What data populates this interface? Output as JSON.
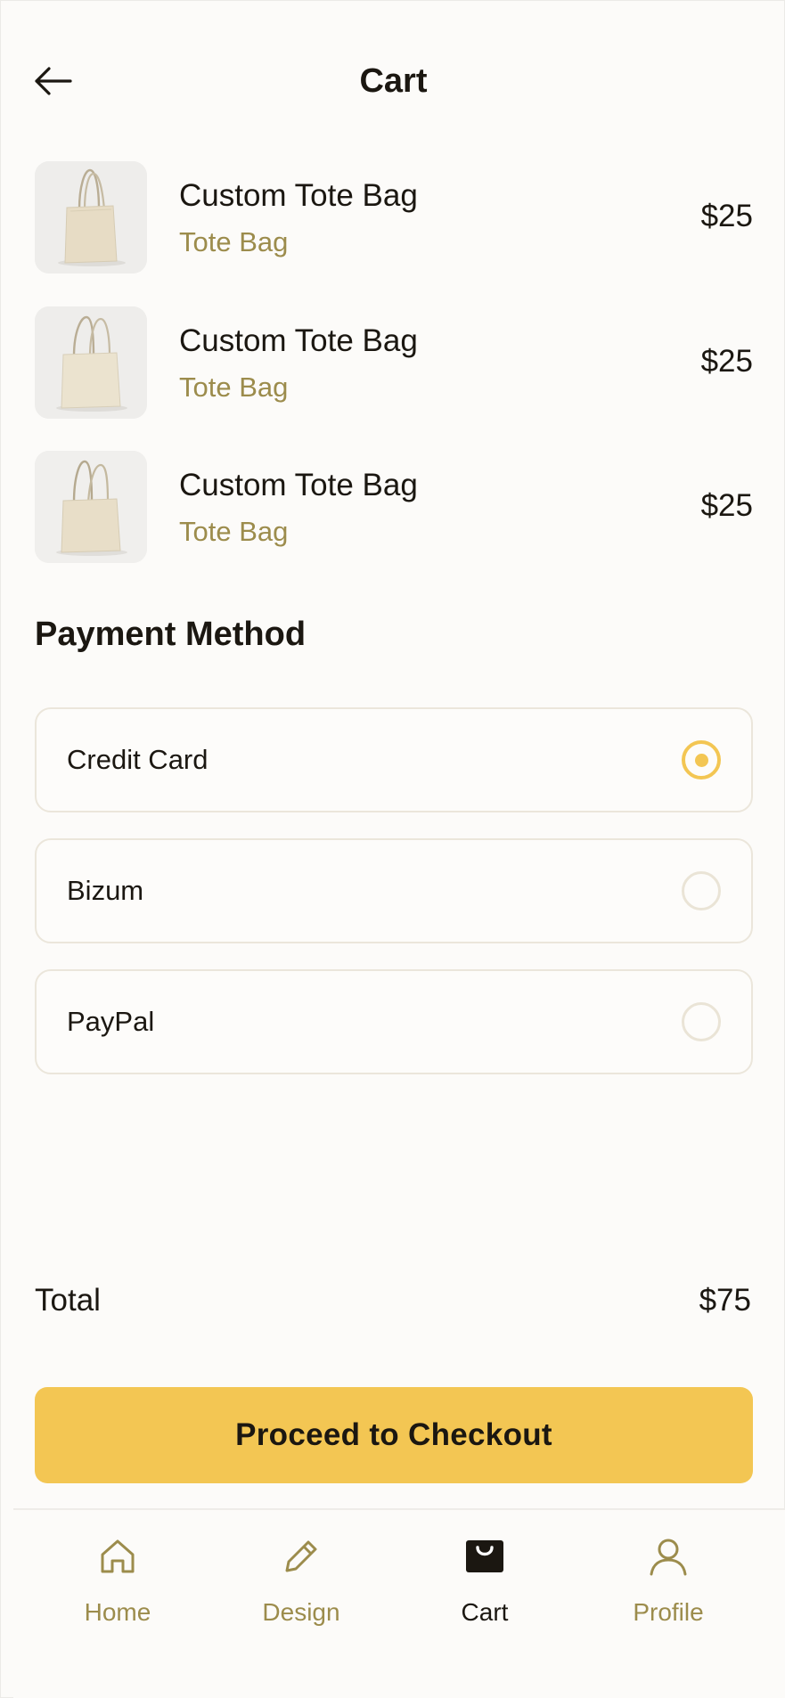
{
  "header": {
    "title": "Cart"
  },
  "cart": {
    "items": [
      {
        "name": "Custom Tote Bag",
        "type": "Tote Bag",
        "price": "$25"
      },
      {
        "name": "Custom Tote Bag",
        "type": "Tote Bag",
        "price": "$25"
      },
      {
        "name": "Custom Tote Bag",
        "type": "Tote Bag",
        "price": "$25"
      }
    ]
  },
  "payment": {
    "title": "Payment Method",
    "options": [
      {
        "label": "Credit Card",
        "selected": true
      },
      {
        "label": "Bizum",
        "selected": false
      },
      {
        "label": "PayPal",
        "selected": false
      }
    ]
  },
  "summary": {
    "total_label": "Total",
    "total_value": "$75",
    "checkout_label": "Proceed to Checkout"
  },
  "nav": {
    "items": [
      {
        "label": "Home",
        "icon": "home-icon",
        "active": false
      },
      {
        "label": "Design",
        "icon": "pencil-icon",
        "active": false
      },
      {
        "label": "Cart",
        "icon": "shopping-bag-icon",
        "active": true
      },
      {
        "label": "Profile",
        "icon": "user-icon",
        "active": false
      }
    ]
  },
  "colors": {
    "accent": "#f3c653",
    "muted_gold": "#9c8c4c",
    "text": "#1b1711",
    "background": "#fcfbf9",
    "border": "#ebe6db"
  }
}
